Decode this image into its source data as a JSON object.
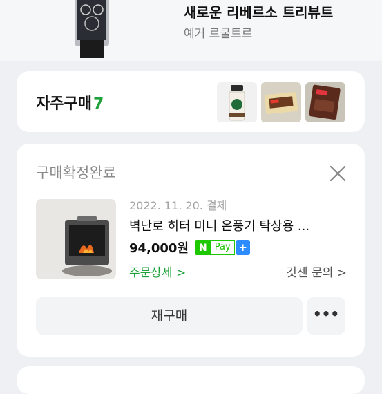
{
  "promo": {
    "title": "새로운 리베르소 트리뷰트",
    "subtitle": "예거 르쿨트르",
    "image_icon": "watch-image"
  },
  "frequent": {
    "label": "자주구매",
    "count": "7",
    "thumbnails": [
      "coffee-bottle-image",
      "snack-bar-image",
      "chocolate-bar-image"
    ]
  },
  "order": {
    "status": "구매확정완료",
    "date": "2022. 11. 20. 결제",
    "product_name": "벽난로 히터 미니 온풍기 탁상용 ...",
    "price": "94,000원",
    "pay_badge": {
      "n": "N",
      "pay": "Pay",
      "plus": "+"
    },
    "detail_link": "주문상세 >",
    "seller_inquiry": "갓센 문의 >",
    "rebuy_label": "재구매",
    "more_label": "•••"
  },
  "colors": {
    "accent_green": "#1fa23c",
    "npay_green": "#1ec800",
    "npay_blue": "#2d8cff"
  }
}
